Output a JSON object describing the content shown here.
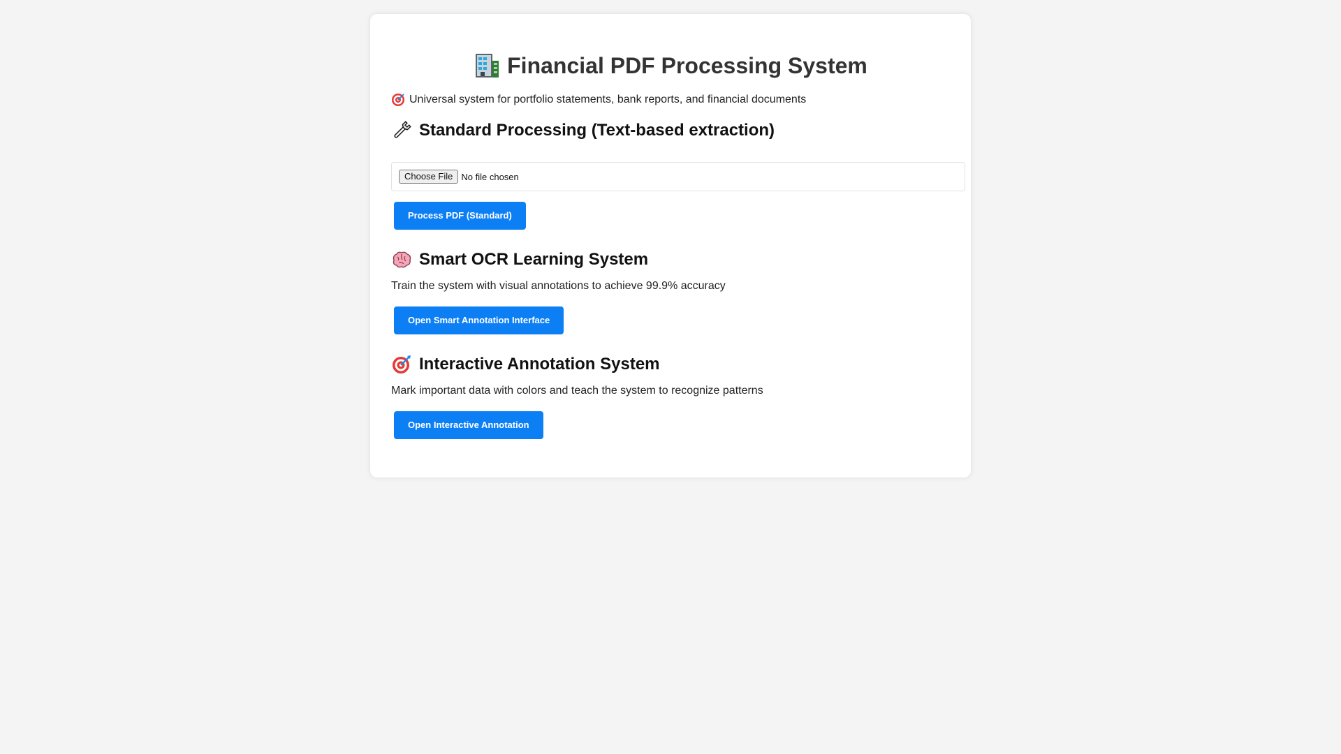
{
  "header": {
    "icon": "office-building-icon",
    "title": "Financial PDF Processing System",
    "subtitle_icon": "target-icon",
    "subtitle": "Universal system for portfolio statements, bank reports, and financial documents"
  },
  "standard": {
    "icon": "wrench-icon",
    "heading": "Standard Processing (Text-based extraction)",
    "file_button": "Choose File",
    "file_status": "No file chosen",
    "process_button": "Process PDF (Standard)"
  },
  "smart_ocr": {
    "icon": "brain-icon",
    "heading": "Smart OCR Learning System",
    "description": "Train the system with visual annotations to achieve 99.9% accuracy",
    "button": "Open Smart Annotation Interface"
  },
  "interactive": {
    "icon": "target-icon",
    "heading": "Interactive Annotation System",
    "description": "Mark important data with colors and teach the system to recognize patterns",
    "button": "Open Interactive Annotation"
  },
  "colors": {
    "accent": "#0d7ff5",
    "background": "#f4f4f4",
    "card": "#ffffff"
  }
}
